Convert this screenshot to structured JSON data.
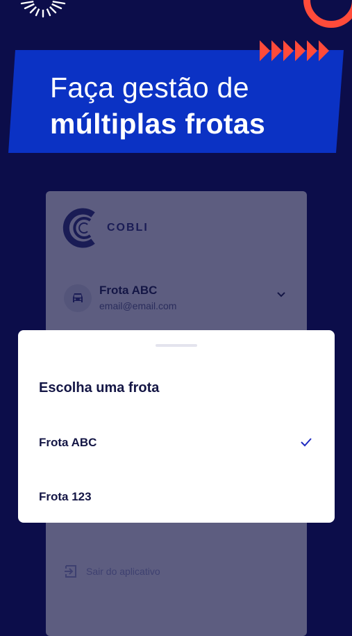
{
  "headline": {
    "line1": "Faça gestão de",
    "line2": "múltiplas frotas"
  },
  "app": {
    "logo_text": "COBLI",
    "current_fleet": {
      "name": "Frota ABC",
      "email": "email@email.com"
    },
    "logout_label": "Sair do aplicativo"
  },
  "sheet": {
    "title": "Escolha uma frota",
    "options": [
      {
        "label": "Frota ABC",
        "selected": true
      },
      {
        "label": "Frota 123",
        "selected": false
      }
    ]
  },
  "colors": {
    "background": "#0c0d4a",
    "banner": "#0b32c4",
    "accent": "#ff4b3a",
    "check": "#1f2bc1"
  },
  "icons": [
    "sun-rays-icon",
    "arrows-icon",
    "cobli-logo-icon",
    "car-icon",
    "chevron-down-icon",
    "check-icon",
    "logout-icon"
  ]
}
